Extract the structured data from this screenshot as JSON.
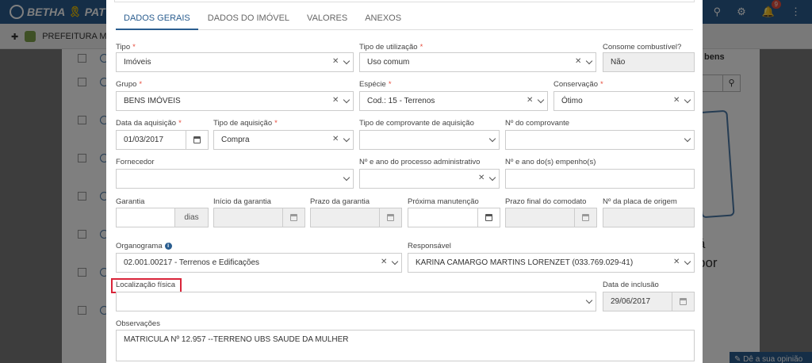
{
  "app": {
    "brand": "BETHA",
    "brand_suffix": "PAT",
    "notification_count": "9",
    "subheader": "PREFEITURA MUN",
    "right_panel_title": "bens",
    "bg_big_text_1": "á",
    "bg_big_text_2": "por",
    "feedback_label": "Dê a sua opinião"
  },
  "tabs": [
    {
      "label": "DADOS GERAIS",
      "active": true
    },
    {
      "label": "DADOS DO IMÓVEL"
    },
    {
      "label": "VALORES"
    },
    {
      "label": "ANEXOS"
    }
  ],
  "form": {
    "tipo": {
      "label": "Tipo",
      "value": "Imóveis"
    },
    "tipo_utilizacao": {
      "label": "Tipo de utilização",
      "value": "Uso comum"
    },
    "consome_combustivel": {
      "label": "Consome combustível?",
      "value": "Não"
    },
    "grupo": {
      "label": "Grupo",
      "value": "BENS IMÓVEIS"
    },
    "especie": {
      "label": "Espécie",
      "value": "Cod.: 15 - Terrenos"
    },
    "conservacao": {
      "label": "Conservação",
      "value": "Ótimo"
    },
    "data_aquisicao": {
      "label": "Data da aquisição",
      "value": "01/03/2017"
    },
    "tipo_aquisicao": {
      "label": "Tipo de aquisição",
      "value": "Compra"
    },
    "tipo_comprovante": {
      "label": "Tipo de comprovante de aquisição",
      "value": ""
    },
    "numero_comprovante": {
      "label": "Nº do comprovante",
      "value": ""
    },
    "fornecedor": {
      "label": "Fornecedor",
      "value": ""
    },
    "processo_administrativo": {
      "label": "Nº e ano do processo administrativo",
      "value": ""
    },
    "empenhos": {
      "label": "Nº e ano do(s) empenho(s)",
      "value": ""
    },
    "garantia": {
      "label": "Garantia",
      "value": "",
      "addon": "dias"
    },
    "inicio_garantia": {
      "label": "Início da garantia",
      "value": ""
    },
    "prazo_garantia": {
      "label": "Prazo da garantia",
      "value": ""
    },
    "proxima_manutencao": {
      "label": "Próxima manutenção",
      "value": ""
    },
    "prazo_comodato": {
      "label": "Prazo final do comodato",
      "value": ""
    },
    "placa_origem": {
      "label": "Nº da placa de origem",
      "value": ""
    },
    "organograma": {
      "label": "Organograma",
      "value": "02.001.00217 - Terrenos e Edificações"
    },
    "responsavel": {
      "label": "Responsável",
      "value": "KARINA CAMARGO MARTINS LORENZET (033.769.029-41)"
    },
    "localizacao_fisica": {
      "label": "Localização física",
      "value": ""
    },
    "data_inclusao": {
      "label": "Data de inclusão",
      "value": "29/06/2017"
    },
    "observacoes": {
      "label": "Observações",
      "value": "MATRICULA Nº 12.957 --TERRENO UBS SAUDE DA MULHER"
    }
  },
  "colors": {
    "primary": "#2a5d8f",
    "required": "#e74c3c",
    "highlight": "#d9253a"
  }
}
